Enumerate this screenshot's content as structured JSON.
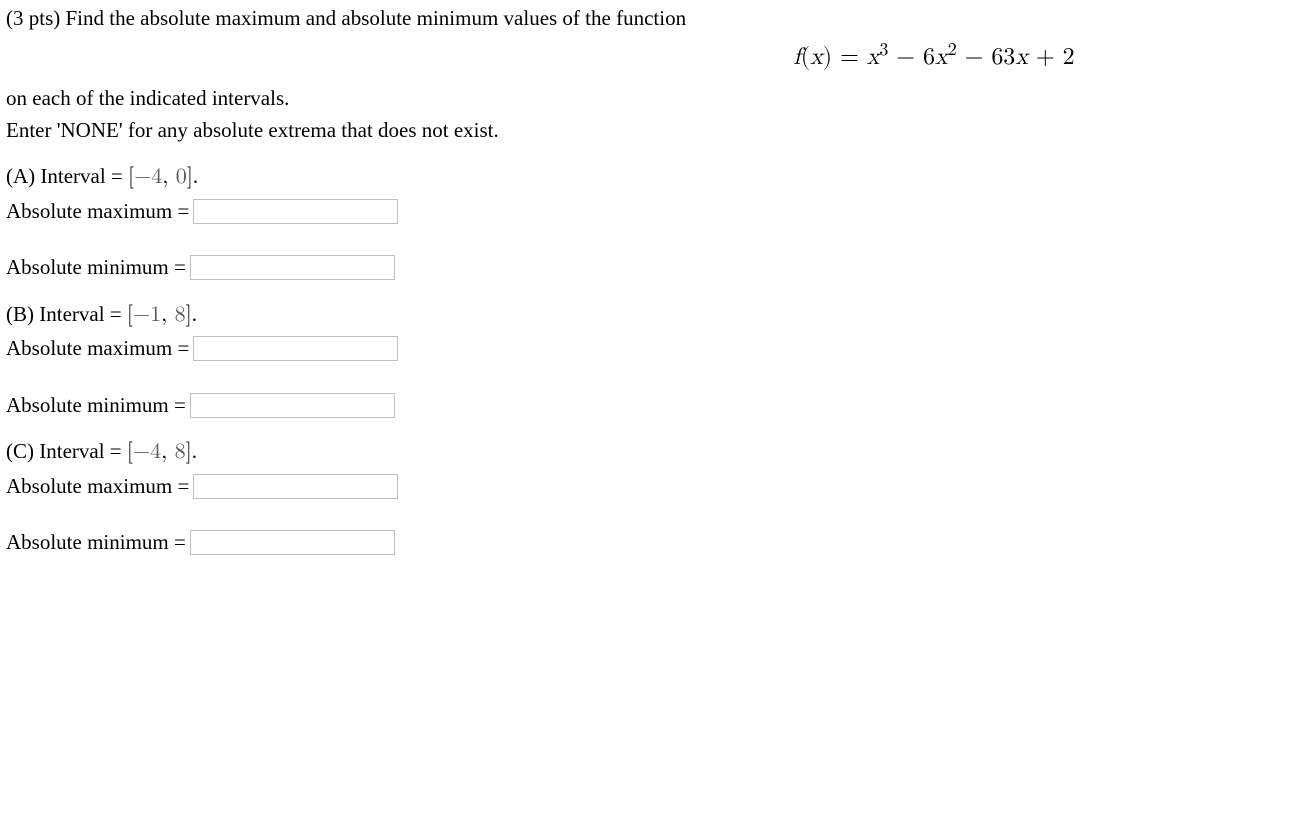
{
  "intro": {
    "points_prefix": "(3 pts) ",
    "line1_rest": "Find the absolute maximum and absolute minimum values of the function",
    "line2": "on each of the indicated intervals.",
    "line3": "Enter 'NONE' for any absolute extrema that does not exist."
  },
  "formula": {
    "f": "f",
    "open": "(",
    "x": "x",
    "close": ")",
    "eq": " = ",
    "term1_var": "x",
    "term1_pow": "3",
    "minus1": " − ",
    "term2_coef": "6",
    "term2_var": "x",
    "term2_pow": "2",
    "minus2": " − ",
    "term3_coef": "63",
    "term3_var": "x",
    "plus": " + ",
    "term4": "2"
  },
  "labels": {
    "interval_eq": "Interval = ",
    "abs_max_eq": "Absolute maximum = ",
    "abs_min_eq": "Absolute minimum = "
  },
  "parts": {
    "A": {
      "letter": "(A) ",
      "lbr": "[",
      "a": "−4",
      "comma": ", ",
      "b": "0",
      "rbr": "]",
      "dot": ".",
      "max_value": "",
      "min_value": ""
    },
    "B": {
      "letter": "(B) ",
      "lbr": "[",
      "a": "−1",
      "comma": ", ",
      "b": "8",
      "rbr": "]",
      "dot": ".",
      "max_value": "",
      "min_value": ""
    },
    "C": {
      "letter": "(C) ",
      "lbr": "[",
      "a": "−4",
      "comma": ", ",
      "b": "8",
      "rbr": "]",
      "dot": ".",
      "max_value": "",
      "min_value": ""
    }
  }
}
